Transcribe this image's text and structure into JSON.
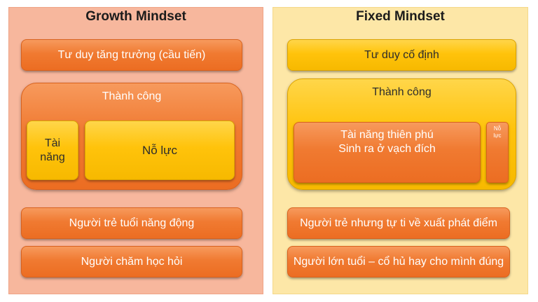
{
  "growth": {
    "title": "Growth Mindset",
    "header": "Tư duy tăng trưởng (cầu tiến)",
    "success_title": "Thành công",
    "talent": "Tài năng",
    "effort": "Nỗ lực",
    "item1": "Người trẻ tuổi năng động",
    "item2": "Người chăm học hỏi"
  },
  "fixed": {
    "title": "Fixed Mindset",
    "header": "Tư duy cố định",
    "success_title": "Thành công",
    "talent_line1": "Tài năng thiên phú",
    "talent_line2": "Sinh ra ở vạch đích",
    "effort": "Nỗ lực",
    "item1": "Người trẻ nhưng tự ti về xuất phát điểm",
    "item2": "Người lớn tuổi – cổ hủ hay cho mình đúng"
  },
  "colors": {
    "left_panel": "#f7b79d",
    "right_panel": "#fde7a7",
    "orange_box": "#f07a31",
    "yellow_box": "#ffc30b"
  }
}
